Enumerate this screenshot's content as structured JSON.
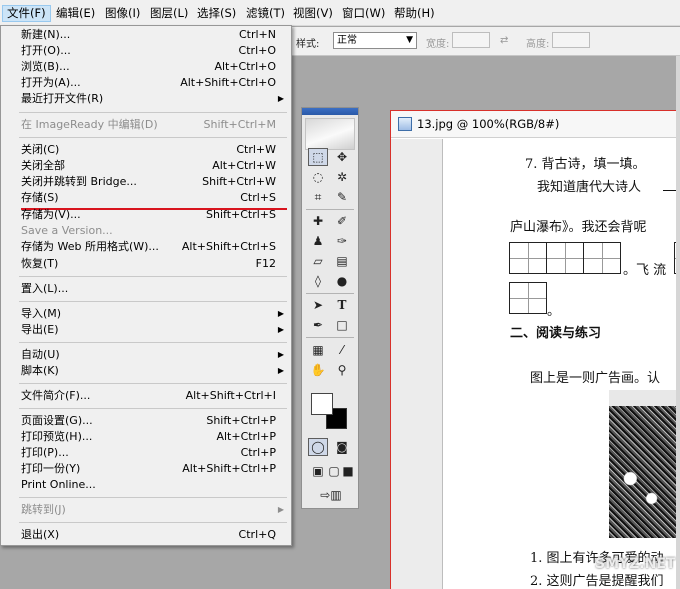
{
  "menubar": [
    "文件(F)",
    "编辑(E)",
    "图像(I)",
    "图层(L)",
    "选择(S)",
    "滤镜(T)",
    "视图(V)",
    "窗口(W)",
    "帮助(H)"
  ],
  "options_bar": {
    "style_label": "样式:",
    "style_value": "正常",
    "width_label": "宽度:",
    "height_label": "高度:"
  },
  "file_menu": [
    {
      "label": "新建(N)...",
      "shortcut": "Ctrl+N"
    },
    {
      "label": "打开(O)...",
      "shortcut": "Ctrl+O"
    },
    {
      "label": "浏览(B)...",
      "shortcut": "Alt+Ctrl+O"
    },
    {
      "label": "打开为(A)...",
      "shortcut": "Alt+Shift+Ctrl+O"
    },
    {
      "label": "最近打开文件(R)",
      "shortcut": ""
    },
    {
      "label": "在 ImageReady 中编辑(D)",
      "shortcut": "Shift+Ctrl+M"
    },
    {
      "label": "关闭(C)",
      "shortcut": "Ctrl+W"
    },
    {
      "label": "关闭全部",
      "shortcut": "Alt+Ctrl+W"
    },
    {
      "label": "关闭并跳转到 Bridge...",
      "shortcut": "Shift+Ctrl+W"
    },
    {
      "label": "存储(S)",
      "shortcut": "Ctrl+S"
    },
    {
      "label": "存储为(V)...",
      "shortcut": "Shift+Ctrl+S"
    },
    {
      "label": "Save a Version...",
      "shortcut": ""
    },
    {
      "label": "存储为 Web 所用格式(W)...",
      "shortcut": "Alt+Shift+Ctrl+S"
    },
    {
      "label": "恢复(T)",
      "shortcut": "F12"
    },
    {
      "label": "置入(L)...",
      "shortcut": ""
    },
    {
      "label": "导入(M)",
      "shortcut": ""
    },
    {
      "label": "导出(E)",
      "shortcut": ""
    },
    {
      "label": "自动(U)",
      "shortcut": ""
    },
    {
      "label": "脚本(K)",
      "shortcut": ""
    },
    {
      "label": "文件简介(F)...",
      "shortcut": "Alt+Shift+Ctrl+I"
    },
    {
      "label": "页面设置(G)...",
      "shortcut": "Shift+Ctrl+P"
    },
    {
      "label": "打印预览(H)...",
      "shortcut": "Alt+Ctrl+P"
    },
    {
      "label": "打印(P)...",
      "shortcut": "Ctrl+P"
    },
    {
      "label": "打印一份(Y)",
      "shortcut": "Alt+Shift+Ctrl+P"
    },
    {
      "label": "Print Online...",
      "shortcut": ""
    },
    {
      "label": "跳转到(J)",
      "shortcut": ""
    },
    {
      "label": "退出(X)",
      "shortcut": "Ctrl+Q"
    }
  ],
  "tools": {
    "type_label": "T"
  },
  "document": {
    "title": "13.jpg @ 100%(RGB/8#)",
    "lines": [
      "7. 背古诗，填一填。",
      "我知道唐代大诗人",
      "庐山瀑布》。我还会背呢",
      "。飞 流",
      "。",
      "二、阅读与练习",
      "图上是一则广告画。认",
      "1. 图上有许多可爱的动",
      "2. 这则广告是提醒我们"
    ],
    "watermark": "SMYZ.NET"
  }
}
